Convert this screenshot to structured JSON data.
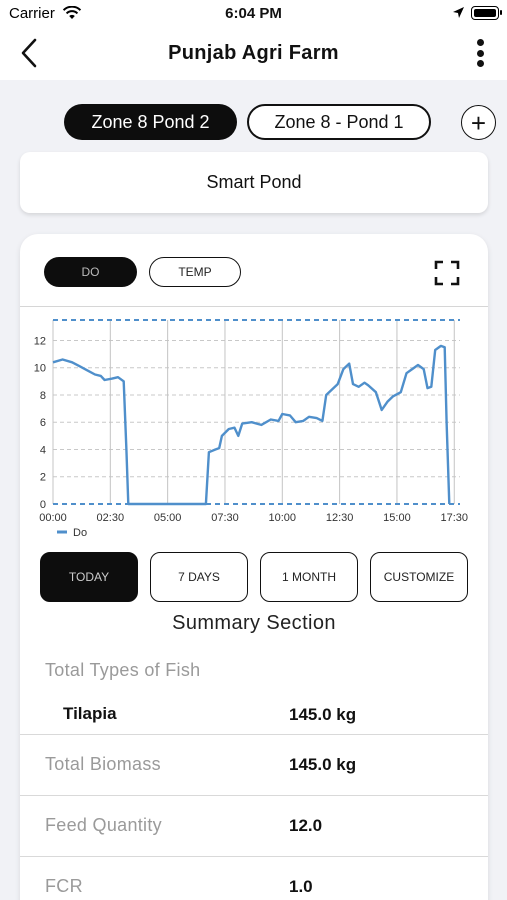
{
  "status_bar": {
    "carrier": "Carrier",
    "time": "6:04 PM"
  },
  "header": {
    "title": "Punjab Agri Farm"
  },
  "ponds": {
    "tabs": [
      {
        "label": "Zone 8 Pond 2",
        "selected": true
      },
      {
        "label": "Zone 8 - Pond 1",
        "selected": false
      }
    ],
    "add_label": "+"
  },
  "device": {
    "name": "Smart Pond"
  },
  "parameters": [
    {
      "label": "DO",
      "selected": true
    },
    {
      "label": "TEMP",
      "selected": false
    }
  ],
  "chart_data": {
    "type": "line",
    "x_tick_labels": [
      "00:00",
      "02:30",
      "05:00",
      "07:30",
      "10:00",
      "12:30",
      "15:00",
      "17:30"
    ],
    "y_tick_labels": [
      "0",
      "2",
      "4",
      "6",
      "8",
      "10",
      "12"
    ],
    "ylim": [
      0,
      13.5
    ],
    "xlim": [
      "00:00",
      "17:45"
    ],
    "grid": true,
    "legend": "bottom-left",
    "series": [
      {
        "name": "Do",
        "color": "#4f8fcb",
        "points": [
          [
            "00:00",
            10.4
          ],
          [
            "00:25",
            10.6
          ],
          [
            "00:50",
            10.4
          ],
          [
            "01:10",
            10.1
          ],
          [
            "01:30",
            9.8
          ],
          [
            "01:50",
            9.5
          ],
          [
            "02:05",
            9.4
          ],
          [
            "02:15",
            9.1
          ],
          [
            "02:35",
            9.2
          ],
          [
            "02:50",
            9.3
          ],
          [
            "03:05",
            9.0
          ],
          [
            "03:12",
            4.0
          ],
          [
            "03:17",
            0.0
          ],
          [
            "06:40",
            0.0
          ],
          [
            "06:48",
            3.8
          ],
          [
            "07:05",
            4.0
          ],
          [
            "07:15",
            4.1
          ],
          [
            "07:22",
            5.0
          ],
          [
            "07:40",
            5.5
          ],
          [
            "07:55",
            5.6
          ],
          [
            "08:05",
            5.0
          ],
          [
            "08:15",
            5.9
          ],
          [
            "08:40",
            6.0
          ],
          [
            "09:05",
            5.8
          ],
          [
            "09:30",
            6.2
          ],
          [
            "09:50",
            6.1
          ],
          [
            "10:00",
            6.6
          ],
          [
            "10:20",
            6.5
          ],
          [
            "10:35",
            6.0
          ],
          [
            "10:55",
            6.1
          ],
          [
            "11:10",
            6.4
          ],
          [
            "11:30",
            6.3
          ],
          [
            "11:45",
            6.1
          ],
          [
            "11:55",
            8.0
          ],
          [
            "12:10",
            8.4
          ],
          [
            "12:25",
            8.8
          ],
          [
            "12:40",
            9.9
          ],
          [
            "12:55",
            10.3
          ],
          [
            "13:05",
            8.8
          ],
          [
            "13:20",
            8.6
          ],
          [
            "13:35",
            8.9
          ],
          [
            "13:45",
            8.7
          ],
          [
            "14:05",
            8.2
          ],
          [
            "14:20",
            6.9
          ],
          [
            "14:35",
            7.5
          ],
          [
            "14:50",
            7.9
          ],
          [
            "15:10",
            8.2
          ],
          [
            "15:25",
            9.6
          ],
          [
            "15:40",
            9.9
          ],
          [
            "15:55",
            10.2
          ],
          [
            "16:10",
            9.9
          ],
          [
            "16:20",
            8.5
          ],
          [
            "16:30",
            8.6
          ],
          [
            "16:40",
            11.3
          ],
          [
            "16:55",
            11.6
          ],
          [
            "17:05",
            11.5
          ],
          [
            "17:10",
            6.0
          ],
          [
            "17:17",
            0.0
          ]
        ]
      }
    ],
    "reference_lines": [
      {
        "y": 13.5,
        "style": "dashed",
        "color": "#4f8fcb"
      },
      {
        "y": 0,
        "style": "dashed",
        "color": "#4f8fcb"
      }
    ]
  },
  "ranges": [
    {
      "label": "TODAY",
      "selected": true
    },
    {
      "label": "7 DAYS",
      "selected": false
    },
    {
      "label": "1 MONTH",
      "selected": false
    },
    {
      "label": "CUSTOMIZE",
      "selected": false
    }
  ],
  "summary": {
    "title": "Summary Section",
    "fish_types_label": "Total Types of Fish",
    "fish": [
      {
        "name": "Tilapia",
        "weight": "145.0 kg"
      }
    ],
    "rows": [
      {
        "label": "Total Biomass",
        "value": "145.0 kg"
      },
      {
        "label": "Feed Quantity",
        "value": "12.0"
      },
      {
        "label": "FCR",
        "value": "1.0"
      }
    ]
  }
}
